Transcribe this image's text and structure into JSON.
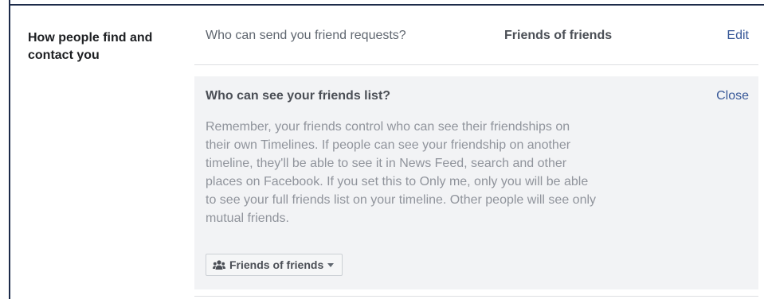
{
  "section": {
    "heading": "How people find and contact you"
  },
  "friend_requests": {
    "question": "Who can send you friend requests?",
    "value": "Friends of friends",
    "edit_label": "Edit"
  },
  "friends_list": {
    "title": "Who can see your friends list?",
    "close_label": "Close",
    "description": "Remember, your friends control who can see their friendships on\ntheir own Timelines. If people can see your friendship on another\ntimeline, they'll be able to see it in News Feed, search and other\nplaces on Facebook. If you set this to Only me, only you will be able\nto see your full friends list on your timeline. Other people will see only\nmutual friends.",
    "audience": {
      "selected": "Friends of friends",
      "icon": "people-icon"
    }
  },
  "colors": {
    "link": "#385898",
    "panel_bg": "#f2f3f5",
    "frame_border": "#1c2b4a"
  }
}
